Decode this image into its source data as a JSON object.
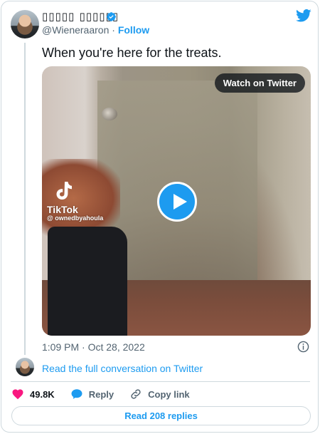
{
  "author": {
    "display_name": "▯▯▯▯▯ ▯▯▯▯▯▯",
    "handle": "@Wieneraaron",
    "separator": "·",
    "follow_label": "Follow",
    "verified": true
  },
  "tweet": {
    "text": "When you're here for the treats.",
    "timestamp": "1:09 PM · Oct 28, 2022"
  },
  "media": {
    "watch_label": "Watch on Twitter",
    "tiktok_name": "TikTok",
    "tiktok_handle": "@ ownedbyahoula"
  },
  "conversation_link": "Read the full conversation on Twitter",
  "actions": {
    "likes": "49.8K",
    "reply_label": "Reply",
    "copy_label": "Copy link"
  },
  "read_replies_label": "Read 208 replies",
  "colors": {
    "accent": "#1d9bf0",
    "like": "#f91880",
    "muted": "#536471",
    "border": "#cfd9de"
  }
}
